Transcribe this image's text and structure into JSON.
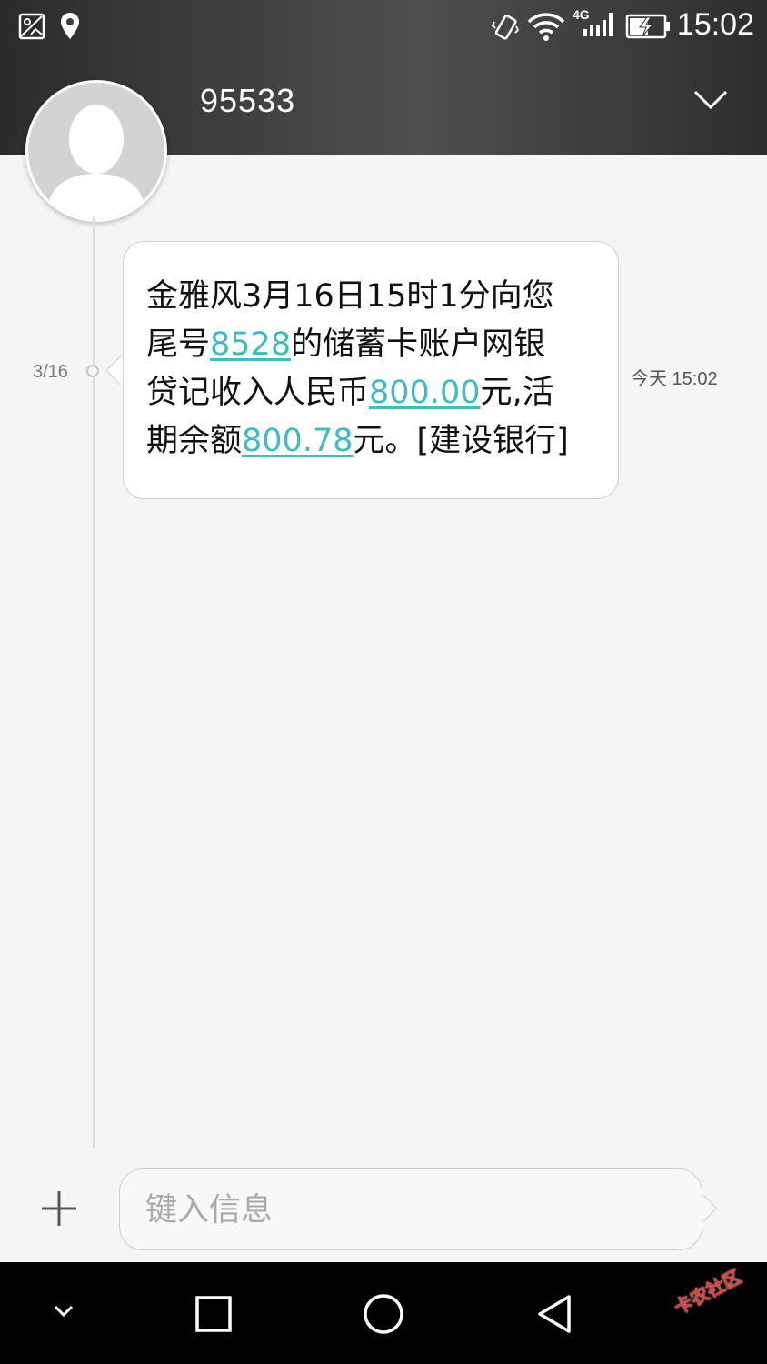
{
  "status_bar": {
    "time": "15:02",
    "network_label": "4G",
    "icons": [
      "gallery-icon",
      "location-pin-icon",
      "vibrate-icon",
      "wifi-icon",
      "signal-4g-icon",
      "battery-charging-icon"
    ]
  },
  "header": {
    "contact_name": "95533",
    "expand_icon": "chevron-down-icon"
  },
  "conversation": {
    "date_label": "3/16",
    "message": {
      "lines": [
        [
          {
            "text": "金雅风3月16日15时1分向您",
            "link": false
          }
        ],
        [
          {
            "text": "尾号",
            "link": false
          },
          {
            "text": "8528",
            "link": true
          },
          {
            "text": "的储蓄卡账户网银",
            "link": false
          }
        ],
        [
          {
            "text": "贷记收入人民币",
            "link": false
          },
          {
            "text": "800.00",
            "link": true
          },
          {
            "text": "元,活",
            "link": false
          }
        ],
        [
          {
            "text": "期余额",
            "link": false
          },
          {
            "text": "800.78",
            "link": true
          },
          {
            "text": "元。[建设银行]",
            "link": false
          }
        ]
      ],
      "time": "今天 15:02"
    }
  },
  "compose": {
    "placeholder": "键入信息",
    "value": ""
  },
  "nav_bar": {
    "buttons": [
      "hide-keyboard",
      "recents",
      "home",
      "back"
    ]
  },
  "watermark": {
    "text": "卡农社区"
  },
  "colors": {
    "link": "#3dbdbd",
    "header": "#3f4241",
    "background": "#f5f5f5"
  }
}
